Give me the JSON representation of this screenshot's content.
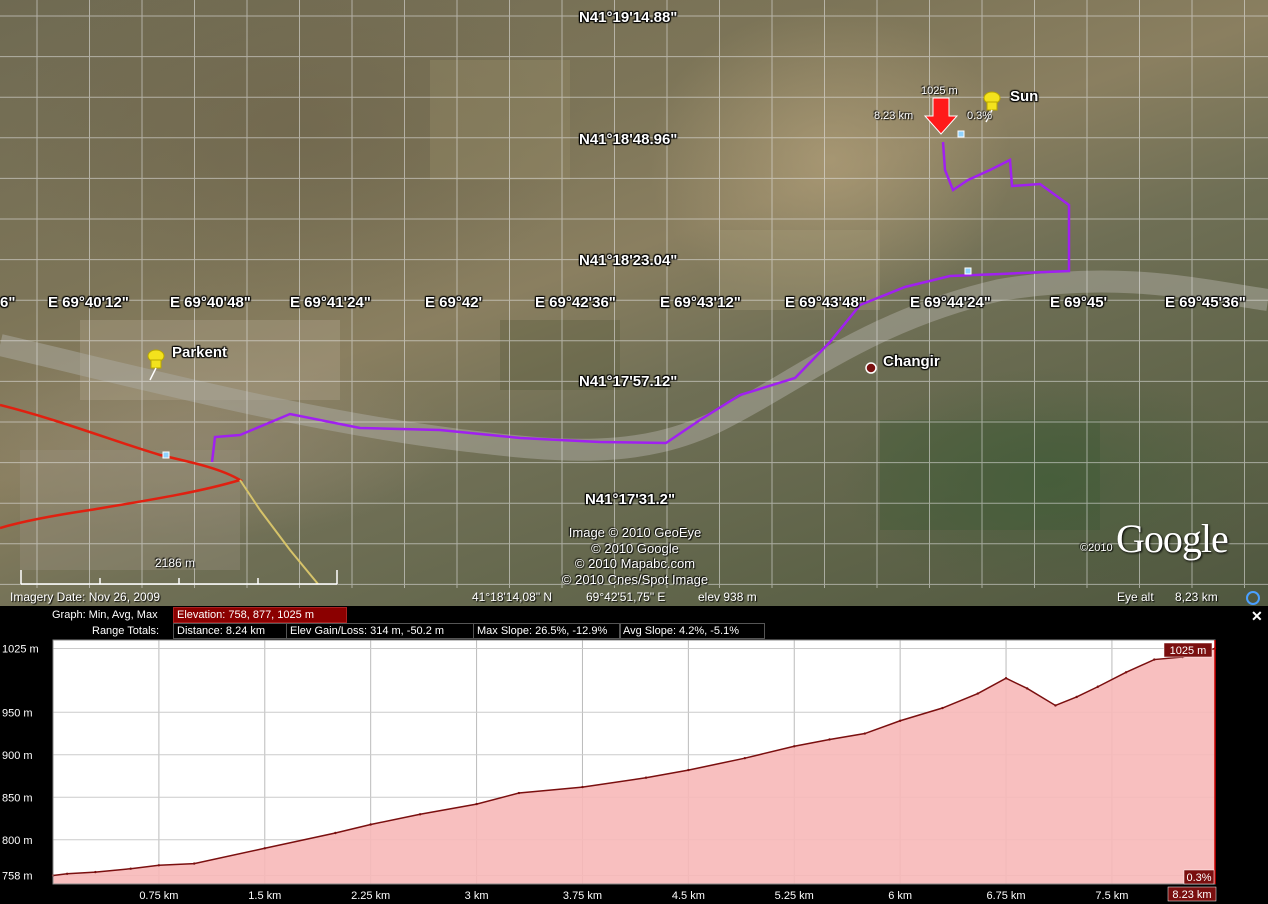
{
  "map": {
    "lat_labels": [
      "N41°19'14.88\"",
      "N41°18'48.96\"",
      "N41°18'23.04\"",
      "N41°17'57.12\"",
      "N41°17'31.2\""
    ],
    "lon_labels": [
      "6\"",
      "E 69°40'12\"",
      "E 69°40'48\"",
      "E 69°41'24\"",
      "E 69°42'",
      "E 69°42'36\"",
      "E 69°43'12\"",
      "E 69°43'48\"",
      "E 69°44'24\"",
      "E 69°45'",
      "E 69°45'36\""
    ],
    "places": {
      "parkent": "Parkent",
      "changir": "Changir",
      "sun": "Sun"
    },
    "marker": {
      "elevation": "1025 m",
      "distance": "8.23 km",
      "slope": "0.3%"
    },
    "scale_label": "2186 m",
    "copyright": [
      "Image © 2010 GeoEye",
      "© 2010 Google",
      "© 2010 Mapabc.com",
      "© 2010 Cnes/Spot Image"
    ],
    "google_year": "©2010",
    "google_logo": "Google",
    "colors": {
      "route": "#a020f0",
      "road": "#e02010",
      "track": "#d6c36a"
    }
  },
  "statusbar": {
    "imagery_date": "Imagery Date: Nov 26, 2009",
    "lat": "41°18'14,08\" N",
    "lon": "69°42'51,75\" E",
    "elev": "elev  938 m",
    "eye_alt_label": "Eye alt",
    "eye_alt_value": "8,23 km"
  },
  "profile": {
    "graph_label": "Graph: Min, Avg, Max",
    "elevation_box": "Elevation: 758, 877, 1025 m",
    "range_label": "Range Totals:",
    "distance_box": "Distance: 8.24 km",
    "gain_box": "Elev Gain/Loss: 314 m, -50.2 m",
    "slope_box": "Max Slope: 26.5%, -12.9%",
    "avg_slope_box": "Avg Slope: 4.2%, -5.1%",
    "max_tag": "1025 m",
    "slope_tag": "0.3%",
    "dist_tag": "8.23 km"
  },
  "chart_data": {
    "type": "area",
    "title": "",
    "xlabel": "",
    "ylabel": "",
    "x_unit": "km",
    "y_unit": "m",
    "xlim": [
      0,
      8.23
    ],
    "ylim": [
      748,
      1035
    ],
    "y_tick_labels": [
      "1025 m",
      "950 m",
      "900 m",
      "850 m",
      "800 m",
      "758 m"
    ],
    "y_ticks": [
      1025,
      950,
      900,
      850,
      800,
      758
    ],
    "x_tick_labels": [
      "0.75 km",
      "1.5 km",
      "2.25 km",
      "3 km",
      "3.75 km",
      "4.5 km",
      "5.25 km",
      "6 km",
      "6.75 km",
      "7.5 km"
    ],
    "x_ticks": [
      0.75,
      1.5,
      2.25,
      3,
      3.75,
      4.5,
      5.25,
      6,
      6.75,
      7.5
    ],
    "x": [
      0,
      0.1,
      0.3,
      0.55,
      0.75,
      1.0,
      1.5,
      2.0,
      2.25,
      2.6,
      3.0,
      3.3,
      3.75,
      4.2,
      4.5,
      4.9,
      5.25,
      5.5,
      5.75,
      6.0,
      6.3,
      6.55,
      6.75,
      6.9,
      7.1,
      7.25,
      7.4,
      7.6,
      7.8,
      8.0,
      8.23
    ],
    "series": [
      {
        "values": [
          758,
          760,
          762,
          766,
          770,
          772,
          790,
          808,
          818,
          830,
          842,
          855,
          862,
          873,
          882,
          896,
          910,
          918,
          925,
          940,
          955,
          972,
          990,
          978,
          958,
          968,
          980,
          997,
          1012,
          1015,
          1025
        ]
      }
    ]
  }
}
